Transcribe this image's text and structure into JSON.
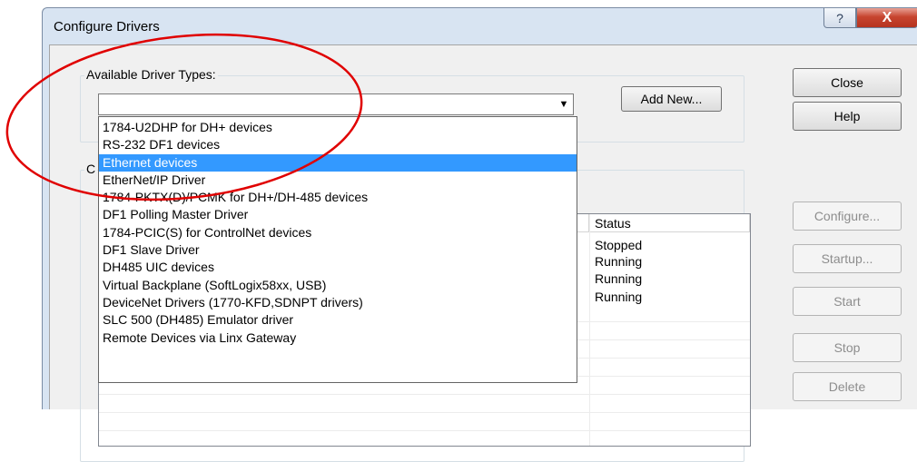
{
  "window": {
    "title": "Configure Drivers",
    "help_icon": "question-mark-icon",
    "close_icon": "close-x-icon"
  },
  "available": {
    "label": "Available Driver Types:",
    "combo_value": "",
    "add_new": "Add New..."
  },
  "dropdown": {
    "items": [
      "1784-U2DHP for DH+ devices",
      "RS-232 DF1 devices",
      "Ethernet devices",
      "EtherNet/IP Driver",
      "1784-PKTX(D)/PCMK for DH+/DH-485 devices",
      "DF1 Polling Master Driver",
      "1784-PCIC(S) for ControlNet devices",
      "DF1 Slave Driver",
      "DH485 UIC devices",
      "Virtual Backplane (SoftLogix58xx, USB)",
      "DeviceNet Drivers (1770-KFD,SDNPT drivers)",
      "SLC 500 (DH485) Emulator driver",
      "Remote Devices via Linx Gateway"
    ],
    "selected_index": 2
  },
  "configured": {
    "group_label_fragment": "C",
    "status_header": "Status",
    "statuses": [
      "Stopped",
      "Running",
      "Running",
      "Running"
    ]
  },
  "buttons": {
    "close": "Close",
    "help": "Help",
    "configure": "Configure...",
    "startup": "Startup...",
    "start": "Start",
    "stop": "Stop",
    "delete": "Delete"
  },
  "colors": {
    "selection": "#3399ff",
    "annotation": "#e00000"
  }
}
